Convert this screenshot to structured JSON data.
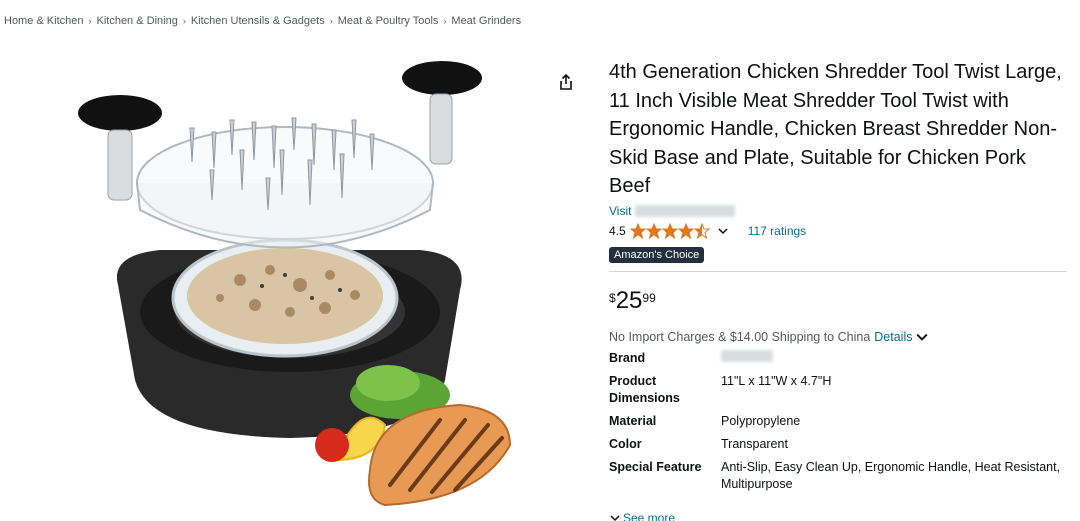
{
  "breadcrumb": [
    "Home & Kitchen",
    "Kitchen & Dining",
    "Kitchen Utensils & Gadgets",
    "Meat & Poultry Tools",
    "Meat Grinders"
  ],
  "product": {
    "title": "4th Generation Chicken Shredder Tool Twist Large, 11 Inch Visible Meat Shredder Tool Twist with Ergonomic Handle, Chicken Breast Shredder Non-Skid Base and Plate, Suitable for Chicken Pork Beef",
    "store_link": "Visit",
    "rating": "4.5",
    "ratings_count": "117 ratings",
    "badge": "Amazon's Choice",
    "price_symbol": "$",
    "price_whole": "25",
    "price_fraction": "99",
    "shipping_text": "No Import Charges & $14.00 Shipping to China",
    "shipping_details": "Details",
    "see_more": "See more"
  },
  "specs": [
    {
      "label": "Brand",
      "value": ""
    },
    {
      "label": "Product Dimensions",
      "value": "11\"L x 11\"W x 4.7\"H"
    },
    {
      "label": "Material",
      "value": "Polypropylene"
    },
    {
      "label": "Color",
      "value": "Transparent"
    },
    {
      "label": "Special Feature",
      "value": "Anti-Slip, Easy Clean Up, Ergonomic Handle, Heat Resistant, Multipurpose"
    }
  ],
  "colors": {
    "link": "#007185",
    "star": "#de7921",
    "badge_bg": "#232f3e"
  },
  "icons": {
    "share": "share-icon",
    "star": "star-icon",
    "chevron": "chevron-down-icon"
  }
}
